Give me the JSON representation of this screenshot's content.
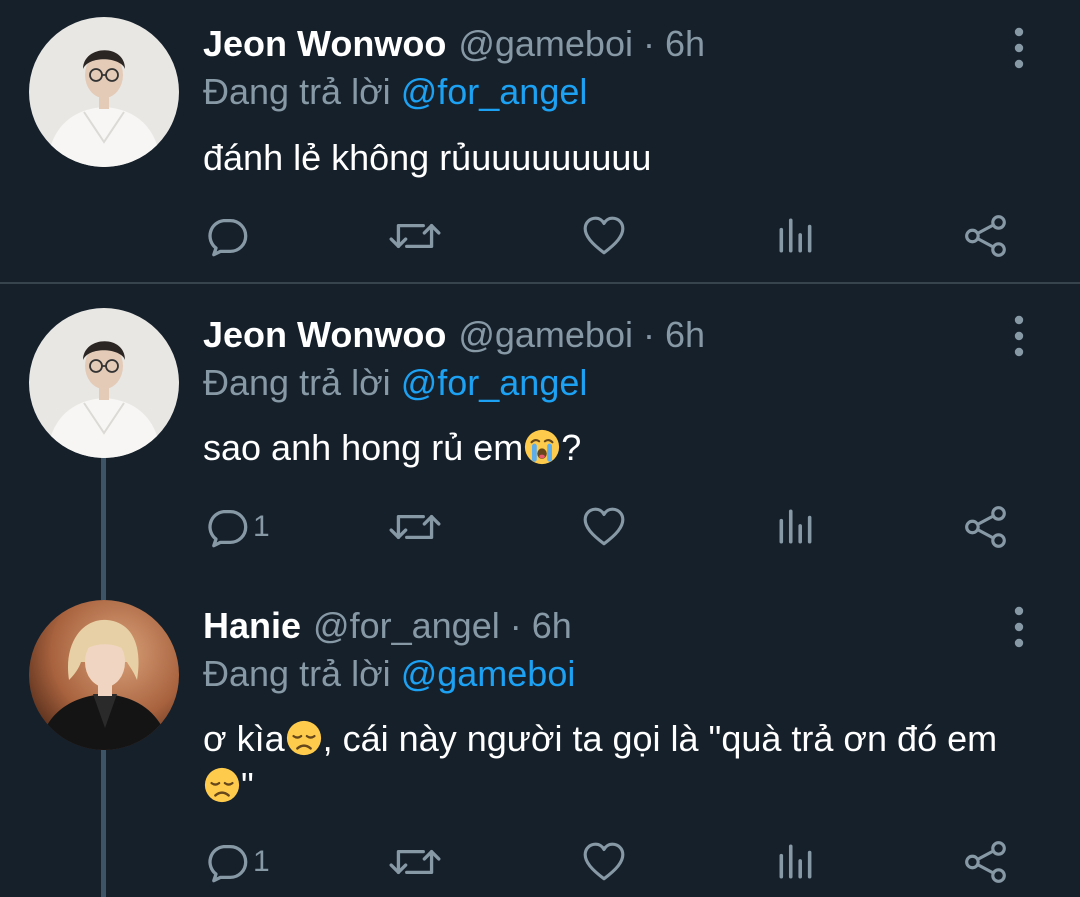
{
  "tweets": [
    {
      "name": "Jeon Wonwoo",
      "handle": "@gameboi",
      "separator": "·",
      "time": "6h",
      "reply_prefix": "Đang trả lời",
      "reply_to": "@for_angel",
      "text_parts": [
        "đánh lẻ không rủuuuuuuuuu"
      ],
      "reply_count": "",
      "avatar": "avatar-jeon-wonwoo"
    },
    {
      "name": "Jeon Wonwoo",
      "handle": "@gameboi",
      "separator": "·",
      "time": "6h",
      "reply_prefix": "Đang trả lời",
      "reply_to": "@for_angel",
      "text_parts": [
        "sao anh hong rủ em",
        "?"
      ],
      "emoji": [
        "crying-face-emoji"
      ],
      "reply_count": "1",
      "avatar": "avatar-jeon-wonwoo"
    },
    {
      "name": "Hanie",
      "handle": "@for_angel",
      "separator": "·",
      "time": "6h",
      "reply_prefix": "Đang trả lời",
      "reply_to": "@gameboi",
      "text_parts": [
        "ơ kìa",
        ", cái này người ta gọi là \"quà trả ơn đó em",
        "\""
      ],
      "emoji": [
        "disappointed-face-emoji",
        "disappointed-face-emoji"
      ],
      "reply_count": "1",
      "avatar": "avatar-hanie"
    }
  ],
  "icons": {
    "reply": "reply-icon",
    "retweet": "retweet-icon",
    "like": "heart-icon",
    "analytics": "analytics-icon",
    "share": "share-icon",
    "more": "more-vertical-icon"
  },
  "colors": {
    "background": "#15202b",
    "primary_text": "#ffffff",
    "secondary_text": "#8899a6",
    "link": "#1da1f2",
    "divider": "#38444d",
    "thread_line": "#3d5466"
  }
}
